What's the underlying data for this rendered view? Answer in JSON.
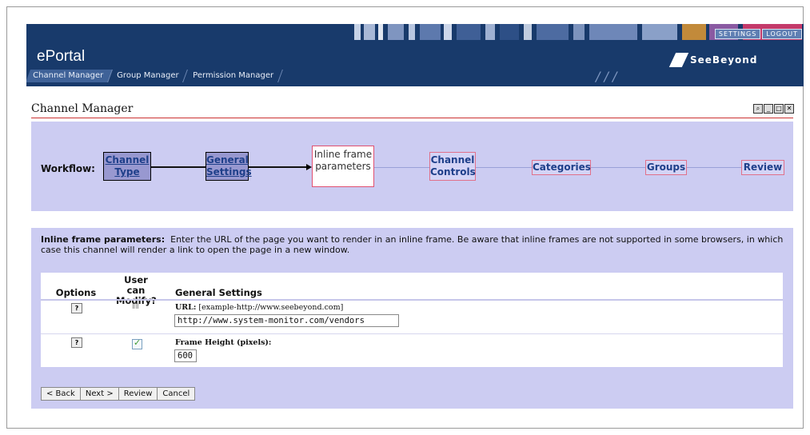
{
  "header": {
    "app_title": "ePortal",
    "nav_tabs": [
      {
        "label": "Channel Manager",
        "active": true
      },
      {
        "label": "Group Manager",
        "active": false
      },
      {
        "label": "Permission Manager",
        "active": false
      }
    ],
    "top_buttons": [
      "SETTINGS",
      "LOGOUT"
    ],
    "brand": "SeeBeyond",
    "colors": {
      "header_bg": "#183a6b"
    }
  },
  "page": {
    "title": "Channel Manager",
    "window_icons": [
      "search-icon",
      "minimize-icon",
      "maximize-icon",
      "close-icon"
    ]
  },
  "workflow": {
    "label": "Workflow:",
    "steps": [
      {
        "label": "Channel Type",
        "state": "done"
      },
      {
        "label": "General Settings",
        "state": "done"
      },
      {
        "label": "Inline frame parameters",
        "state": "current"
      },
      {
        "label": "Channel Controls",
        "state": "todo"
      },
      {
        "label": "Categories",
        "state": "todo"
      },
      {
        "label": "Groups",
        "state": "todo"
      },
      {
        "label": "Review",
        "state": "todo"
      }
    ]
  },
  "params": {
    "heading": "Inline frame parameters:",
    "description": "Enter the URL of the page you want to render in an inline frame. Be aware that inline frames are not supported in some browsers, in which case this channel will render a link to open the page in a new window.",
    "columns": {
      "options": "Options",
      "user_can_modify": "User can Modify?",
      "general_settings": "General Settings"
    },
    "rows": [
      {
        "label": "URL:",
        "hint": "[example-http://www.seebeyond.com]",
        "value": "http://www.system-monitor.com/vendors",
        "user_can_modify": "locked"
      },
      {
        "label": "Frame Height (pixels):",
        "hint": "",
        "value": "600",
        "user_can_modify": "checked"
      }
    ]
  },
  "buttons": {
    "back": "< Back",
    "next": "Next >",
    "review": "Review",
    "cancel": "Cancel"
  }
}
